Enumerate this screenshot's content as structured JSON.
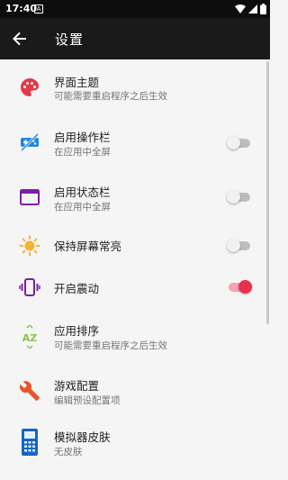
{
  "status_bar": {
    "time": "17:40",
    "notification_glyph": "A",
    "icons": [
      "wifi-icon",
      "signal-icon",
      "battery-icon"
    ]
  },
  "toolbar": {
    "back_icon": "arrow-back-icon",
    "title": "设置"
  },
  "settings": [
    {
      "title": "界面主题",
      "subtitle": "可能需要重启程序之后生效",
      "icon": "palette-icon"
    },
    {
      "title": "启用操作栏",
      "subtitle": "在应用中全屏",
      "icon": "gamepad-off-icon",
      "toggle": false
    },
    {
      "title": "启用状态栏",
      "subtitle": "在应用中全屏",
      "icon": "window-icon",
      "toggle": false
    },
    {
      "title": "保持屏幕常亮",
      "icon": "screen-brightness-icon",
      "toggle": false
    },
    {
      "title": "开启震动",
      "icon": "vibration-icon",
      "toggle": true
    },
    {
      "title": "应用排序",
      "subtitle": "可能需要重启程序之后生效",
      "icon": "sort-az-icon"
    },
    {
      "title": "游戏配置",
      "subtitle": "编辑预设配置项",
      "icon": "wrench-icon"
    },
    {
      "title": "模拟器皮肤",
      "subtitle": "无皮肤",
      "icon": "calculator-icon"
    }
  ],
  "colors": {
    "toolbar_background": "#1a1a1a",
    "status_bar_background": "#0d0d0d",
    "list_background": "#f5f5f5",
    "switch_on": "#e8304e",
    "palette_icon": "#e53947",
    "gamepad_icon": "#1e88e5",
    "window_icon": "#7b1fa2",
    "brightness_icon": "#f9b233",
    "vibration_icon": "#7b1fa2",
    "sort_icon": "#8bc34a",
    "wrench_icon": "#e8542c",
    "calculator_icon": "#1565c0"
  }
}
